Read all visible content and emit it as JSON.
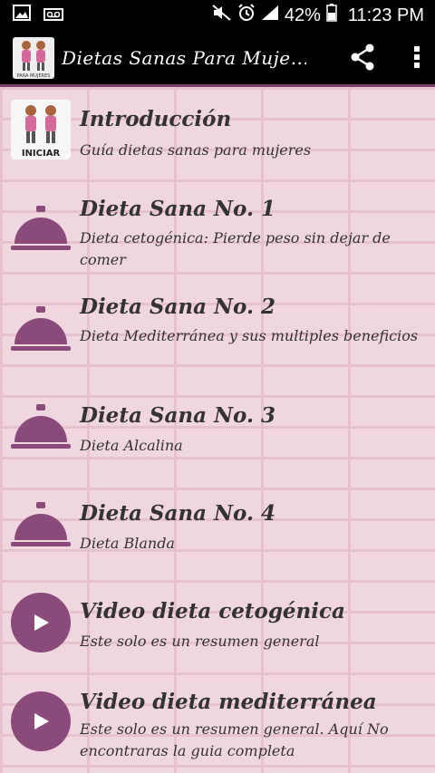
{
  "statusbar": {
    "battery": "42%",
    "time": "11:23 PM",
    "icons": [
      "image-icon",
      "voicemail-icon",
      "mute-icon",
      "alarm-icon",
      "signal-icon",
      "battery-icon"
    ]
  },
  "appbar": {
    "logo_caption": "PARA MUJERES",
    "title": "Dietas Sanas Para Muje...",
    "share_icon": "share-icon",
    "menu_icon": "more-vert-icon"
  },
  "colors": {
    "accent": "#8a4b7b",
    "background": "#f0d6df"
  },
  "items": [
    {
      "title": "Introducción",
      "subtitle": "Guía dietas sanas para mujeres",
      "icon": "iniciar-logo",
      "icon_label": "INICIAR"
    },
    {
      "title": "Dieta Sana No. 1",
      "subtitle": "Dieta cetogénica: Pierde peso sin dejar de comer",
      "icon": "cloche-icon"
    },
    {
      "title": "Dieta Sana No. 2",
      "subtitle": "Dieta Mediterránea y sus multiples beneficios",
      "icon": "cloche-icon"
    },
    {
      "title": "Dieta Sana No. 3",
      "subtitle": "Dieta Alcalina",
      "icon": "cloche-icon"
    },
    {
      "title": "Dieta Sana No. 4",
      "subtitle": "Dieta Blanda",
      "icon": "cloche-icon"
    },
    {
      "title": "Video dieta cetogénica",
      "subtitle": "Este solo es un resumen general",
      "icon": "play-icon"
    },
    {
      "title": "Video dieta mediterránea",
      "subtitle": "Este solo es un resumen general. Aquí No encontraras la guia completa",
      "icon": "play-icon"
    }
  ]
}
